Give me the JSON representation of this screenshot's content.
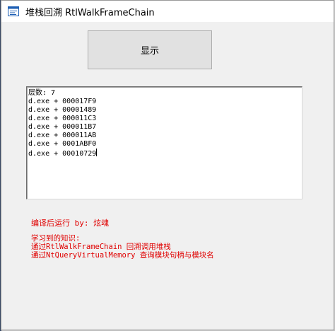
{
  "window": {
    "title": "堆栈回溯 RtlWalkFrameChain"
  },
  "show_button": {
    "label": "显示"
  },
  "output": {
    "lines": [
      "层数: 7",
      "d.exe + 000017F9",
      "d.exe + 00001489",
      "d.exe + 000011C3",
      "d.exe + 000011B7",
      "d.exe + 000011AB",
      "d.exe + 0001ABF0",
      "d.exe + 00010729"
    ]
  },
  "credit": "编译后运行 by: 炫魂",
  "notes": {
    "lines": [
      "学习到的知识:",
      "通过RtlWalkFrameChain 回溯调用堆栈",
      "通过NtQueryVirtualMemory 查询模块句柄与模块名"
    ]
  },
  "colors": {
    "accent_text": "#e00000",
    "window_bg": "#f0f0f0",
    "button_bg": "#e1e1e1"
  },
  "icons": {
    "app": "app-window-icon"
  }
}
